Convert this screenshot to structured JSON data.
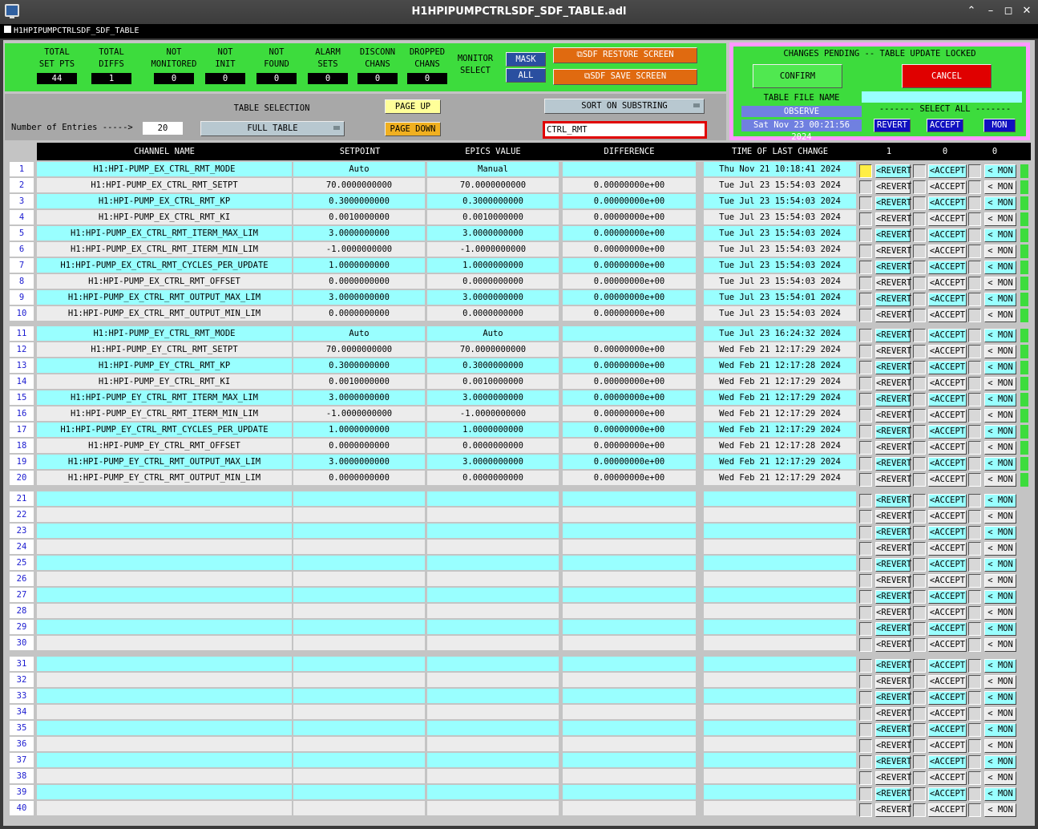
{
  "window": {
    "title": "H1HPIPUMPCTRLSDF_SDF_TABLE.adl",
    "subtitle": "H1HPIPUMPCTRLSDF_SDF_TABLE"
  },
  "stats": [
    {
      "label1": "TOTAL",
      "label2": "SET PTS",
      "value": "44"
    },
    {
      "label1": "TOTAL",
      "label2": "DIFFS",
      "value": "1"
    },
    {
      "label1": "NOT",
      "label2": "MONITORED",
      "value": "0"
    },
    {
      "label1": "NOT",
      "label2": "INIT",
      "value": "0"
    },
    {
      "label1": "NOT",
      "label2": "FOUND",
      "value": "0"
    },
    {
      "label1": "ALARM",
      "label2": "SETS",
      "value": "0"
    },
    {
      "label1": "DISCONN",
      "label2": "CHANS",
      "value": "0"
    },
    {
      "label1": "DROPPED",
      "label2": "CHANS",
      "value": "0"
    }
  ],
  "monitor_select": {
    "label1": "MONITOR",
    "label2": "SELECT",
    "mask": "MASK",
    "all": "ALL"
  },
  "sdf": {
    "restore": "SDF RESTORE SCREEN",
    "save": "SDF SAVE SCREEN"
  },
  "pending": {
    "title": "CHANGES PENDING -- TABLE UPDATE LOCKED",
    "confirm": "CONFIRM",
    "cancel": "CANCEL",
    "file_label": "TABLE FILE NAME",
    "file_name": "OBSERVE",
    "date": "Sat Nov 23 00:21:56 2024",
    "select_all": "------- SELECT ALL -------",
    "revert": "REVERT",
    "accept": "ACCEPT",
    "mon": "MON"
  },
  "controls": {
    "entries_label": "Number of Entries ----->",
    "entries": "20",
    "table_sel": "TABLE SELECTION",
    "full_table": "FULL TABLE",
    "page_up": "PAGE UP",
    "page_down": "PAGE DOWN",
    "sort": "SORT ON SUBSTRING",
    "substring": "CTRL_RMT"
  },
  "headers": {
    "channel": "CHANNEL NAME",
    "setpoint": "SETPOINT",
    "epics": "EPICS VALUE",
    "diff": "DIFFERENCE",
    "time": "TIME OF LAST CHANGE",
    "c1": "1",
    "c2": "0",
    "c3": "0"
  },
  "row_buttons": {
    "revert": "<REVERT",
    "accept": "<ACCEPT",
    "mon": "< MON"
  },
  "rows": [
    {
      "n": "1",
      "ch": "H1:HPI-PUMP_EX_CTRL_RMT_MODE",
      "sp": "Auto",
      "ev": "Manual",
      "df": "",
      "tm": "Thu Nov 21 10:18:41 2024"
    },
    {
      "n": "2",
      "ch": "H1:HPI-PUMP_EX_CTRL_RMT_SETPT",
      "sp": "70.0000000000",
      "ev": "70.0000000000",
      "df": "0.00000000e+00",
      "tm": "Tue Jul 23 15:54:03 2024"
    },
    {
      "n": "3",
      "ch": "H1:HPI-PUMP_EX_CTRL_RMT_KP",
      "sp": "0.3000000000",
      "ev": "0.3000000000",
      "df": "0.00000000e+00",
      "tm": "Tue Jul 23 15:54:03 2024"
    },
    {
      "n": "4",
      "ch": "H1:HPI-PUMP_EX_CTRL_RMT_KI",
      "sp": "0.0010000000",
      "ev": "0.0010000000",
      "df": "0.00000000e+00",
      "tm": "Tue Jul 23 15:54:03 2024"
    },
    {
      "n": "5",
      "ch": "H1:HPI-PUMP_EX_CTRL_RMT_ITERM_MAX_LIM",
      "sp": "3.0000000000",
      "ev": "3.0000000000",
      "df": "0.00000000e+00",
      "tm": "Tue Jul 23 15:54:03 2024"
    },
    {
      "n": "6",
      "ch": "H1:HPI-PUMP_EX_CTRL_RMT_ITERM_MIN_LIM",
      "sp": "-1.0000000000",
      "ev": "-1.0000000000",
      "df": "0.00000000e+00",
      "tm": "Tue Jul 23 15:54:03 2024"
    },
    {
      "n": "7",
      "ch": "H1:HPI-PUMP_EX_CTRL_RMT_CYCLES_PER_UPDATE",
      "sp": "1.0000000000",
      "ev": "1.0000000000",
      "df": "0.00000000e+00",
      "tm": "Tue Jul 23 15:54:03 2024"
    },
    {
      "n": "8",
      "ch": "H1:HPI-PUMP_EX_CTRL_RMT_OFFSET",
      "sp": "0.0000000000",
      "ev": "0.0000000000",
      "df": "0.00000000e+00",
      "tm": "Tue Jul 23 15:54:03 2024"
    },
    {
      "n": "9",
      "ch": "H1:HPI-PUMP_EX_CTRL_RMT_OUTPUT_MAX_LIM",
      "sp": "3.0000000000",
      "ev": "3.0000000000",
      "df": "0.00000000e+00",
      "tm": "Tue Jul 23 15:54:01 2024"
    },
    {
      "n": "10",
      "ch": "H1:HPI-PUMP_EX_CTRL_RMT_OUTPUT_MIN_LIM",
      "sp": "0.0000000000",
      "ev": "0.0000000000",
      "df": "0.00000000e+00",
      "tm": "Tue Jul 23 15:54:03 2024"
    },
    {
      "n": "11",
      "ch": "H1:HPI-PUMP_EY_CTRL_RMT_MODE",
      "sp": "Auto",
      "ev": "Auto",
      "df": "",
      "tm": "Tue Jul 23 16:24:32 2024"
    },
    {
      "n": "12",
      "ch": "H1:HPI-PUMP_EY_CTRL_RMT_SETPT",
      "sp": "70.0000000000",
      "ev": "70.0000000000",
      "df": "0.00000000e+00",
      "tm": "Wed Feb 21 12:17:29 2024"
    },
    {
      "n": "13",
      "ch": "H1:HPI-PUMP_EY_CTRL_RMT_KP",
      "sp": "0.3000000000",
      "ev": "0.3000000000",
      "df": "0.00000000e+00",
      "tm": "Wed Feb 21 12:17:28 2024"
    },
    {
      "n": "14",
      "ch": "H1:HPI-PUMP_EY_CTRL_RMT_KI",
      "sp": "0.0010000000",
      "ev": "0.0010000000",
      "df": "0.00000000e+00",
      "tm": "Wed Feb 21 12:17:29 2024"
    },
    {
      "n": "15",
      "ch": "H1:HPI-PUMP_EY_CTRL_RMT_ITERM_MAX_LIM",
      "sp": "3.0000000000",
      "ev": "3.0000000000",
      "df": "0.00000000e+00",
      "tm": "Wed Feb 21 12:17:29 2024"
    },
    {
      "n": "16",
      "ch": "H1:HPI-PUMP_EY_CTRL_RMT_ITERM_MIN_LIM",
      "sp": "-1.0000000000",
      "ev": "-1.0000000000",
      "df": "0.00000000e+00",
      "tm": "Wed Feb 21 12:17:29 2024"
    },
    {
      "n": "17",
      "ch": "H1:HPI-PUMP_EY_CTRL_RMT_CYCLES_PER_UPDATE",
      "sp": "1.0000000000",
      "ev": "1.0000000000",
      "df": "0.00000000e+00",
      "tm": "Wed Feb 21 12:17:29 2024"
    },
    {
      "n": "18",
      "ch": "H1:HPI-PUMP_EY_CTRL_RMT_OFFSET",
      "sp": "0.0000000000",
      "ev": "0.0000000000",
      "df": "0.00000000e+00",
      "tm": "Wed Feb 21 12:17:28 2024"
    },
    {
      "n": "19",
      "ch": "H1:HPI-PUMP_EY_CTRL_RMT_OUTPUT_MAX_LIM",
      "sp": "3.0000000000",
      "ev": "3.0000000000",
      "df": "0.00000000e+00",
      "tm": "Wed Feb 21 12:17:29 2024"
    },
    {
      "n": "20",
      "ch": "H1:HPI-PUMP_EY_CTRL_RMT_OUTPUT_MIN_LIM",
      "sp": "0.0000000000",
      "ev": "0.0000000000",
      "df": "0.00000000e+00",
      "tm": "Wed Feb 21 12:17:29 2024"
    },
    {
      "n": "21"
    },
    {
      "n": "22"
    },
    {
      "n": "23"
    },
    {
      "n": "24"
    },
    {
      "n": "25"
    },
    {
      "n": "26"
    },
    {
      "n": "27"
    },
    {
      "n": "28"
    },
    {
      "n": "29"
    },
    {
      "n": "30"
    },
    {
      "n": "31"
    },
    {
      "n": "32"
    },
    {
      "n": "33"
    },
    {
      "n": "34"
    },
    {
      "n": "35"
    },
    {
      "n": "36"
    },
    {
      "n": "37"
    },
    {
      "n": "38"
    },
    {
      "n": "39"
    },
    {
      "n": "40"
    }
  ],
  "colors": {
    "cyan": "#99ffff",
    "light": "#ececec",
    "green": "#3ddc3d",
    "orange": "#e06a10",
    "red": "#e00000",
    "blue": "#1010c0"
  }
}
